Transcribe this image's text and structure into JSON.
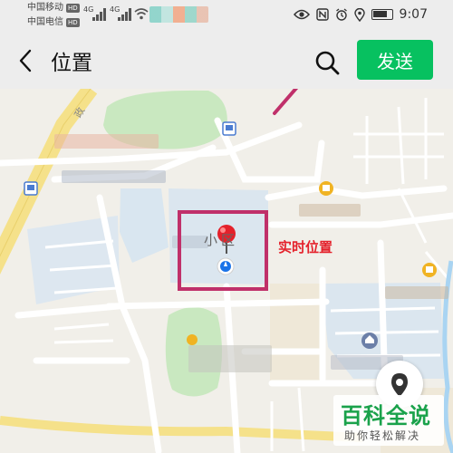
{
  "status_bar": {
    "carrier_1": "中国移动",
    "carrier_2": "中国电信",
    "hd": "HD",
    "network": "4G",
    "time": "9:07"
  },
  "nav": {
    "title": "位置",
    "send_label": "发送"
  },
  "map": {
    "highlight_label": "实时位置",
    "area_label_1": "小",
    "area_label_2": "区",
    "road_label": "政"
  },
  "watermark": {
    "title": "百科全说",
    "subtitle": "助你轻松解决"
  },
  "colors": {
    "accent": "#07c160",
    "highlight_box": "#c0306a",
    "pin_red": "#e4212b",
    "location_dot": "#1a73e8"
  }
}
